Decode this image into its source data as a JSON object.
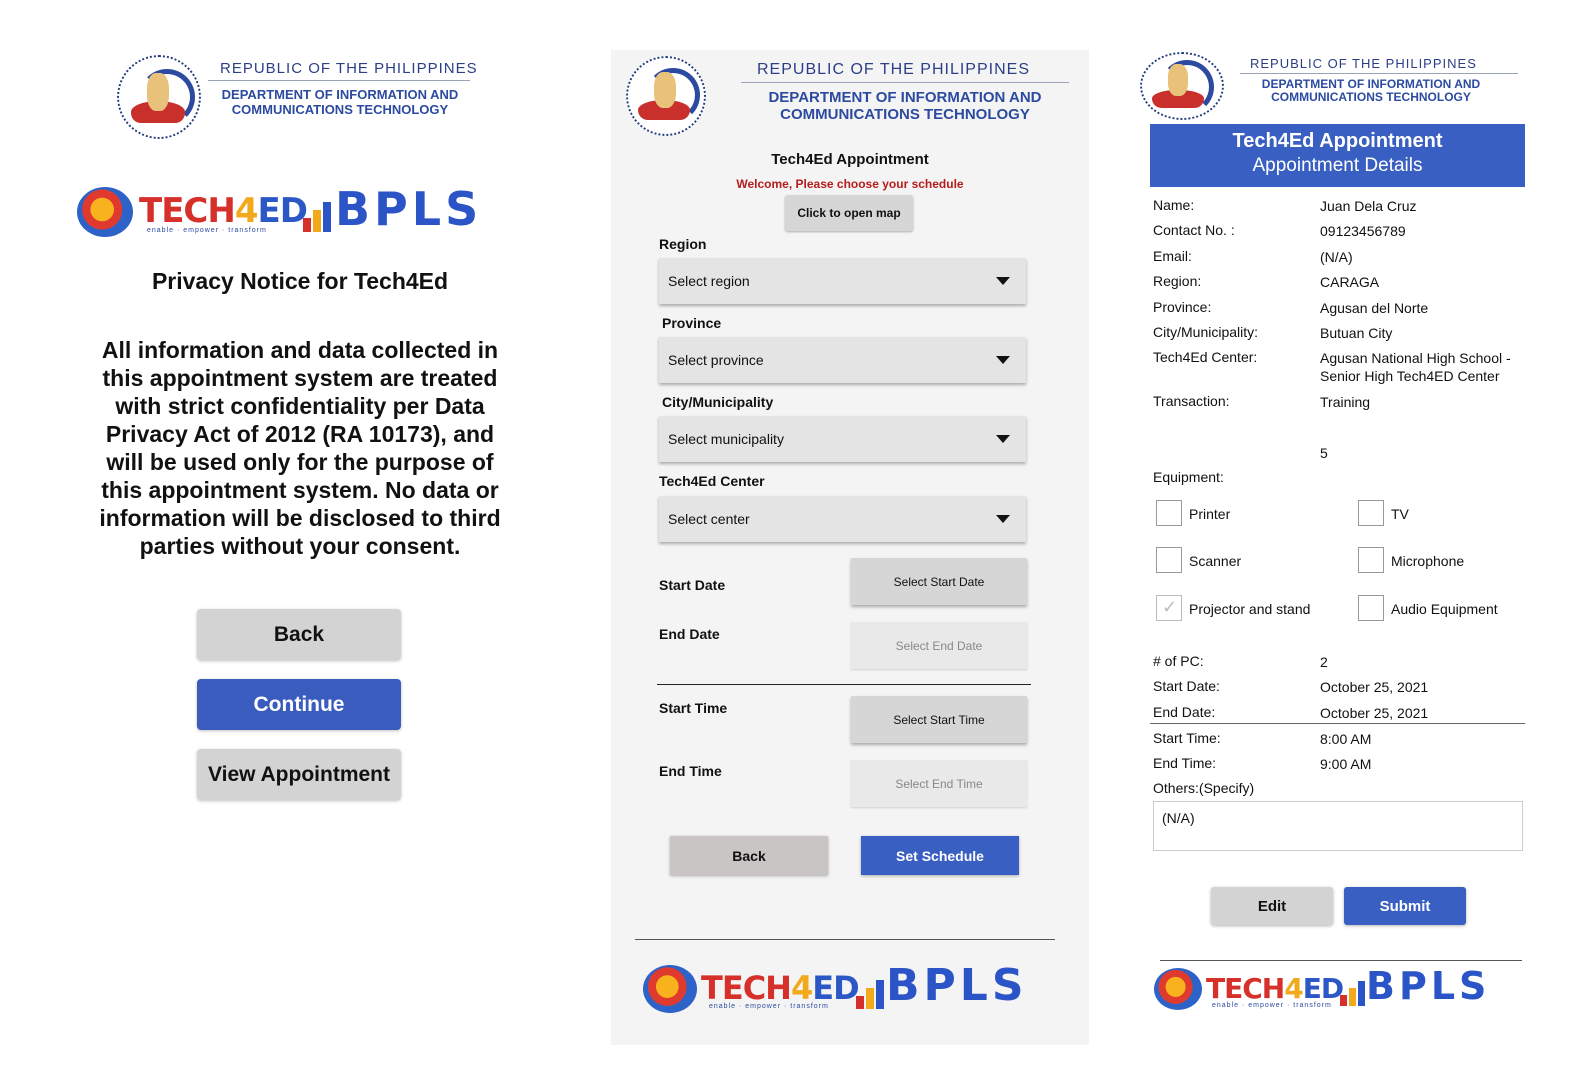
{
  "header": {
    "republic": "REPUBLIC OF THE PHILIPPINES",
    "dept_line1": "DEPARTMENT OF INFORMATION AND",
    "dept_line2": "COMMUNICATIONS TECHNOLOGY"
  },
  "logos": {
    "tech4ed": "TECH4ED",
    "tech4ed_tagline": "enable · empower · transform",
    "bpls": "BPLS"
  },
  "privacy": {
    "title": "Privacy Notice for Tech4Ed",
    "body": "All information and data collected in this appointment system are treated with strict confidentiality per Data Privacy Act of 2012 (RA 10173), and will be used only for the purpose of this appointment system. No data or information will be disclosed to third parties without your consent.",
    "back": "Back",
    "continue": "Continue",
    "view_appointment": "View Appointment"
  },
  "schedule": {
    "title": "Tech4Ed Appointment",
    "welcome": "Welcome, Please choose your schedule",
    "map_button": "Click to open map",
    "region_label": "Region",
    "region_placeholder": "Select region",
    "province_label": "Province",
    "province_placeholder": "Select province",
    "city_label": "City/Municipality",
    "city_placeholder": "Select municipality",
    "center_label": "Tech4Ed Center",
    "center_placeholder": "Select center",
    "start_date_label": "Start Date",
    "start_date_button": "Select Start Date",
    "end_date_label": "End Date",
    "end_date_button": "Select End Date",
    "start_time_label": "Start Time",
    "start_time_button": "Select Start Time",
    "end_time_label": "End Time",
    "end_time_button": "Select End Time",
    "back": "Back",
    "set_schedule": "Set Schedule"
  },
  "details": {
    "title": "Tech4Ed Appointment",
    "subtitle": "Appointment Details",
    "name_k": "Name:",
    "name_v": "Juan Dela Cruz",
    "contact_k": "Contact No. :",
    "contact_v": "09123456789",
    "email_k": "Email:",
    "email_v": "(N/A)",
    "region_k": "Region:",
    "region_v": "CARAGA",
    "province_k": "Province:",
    "province_v": "Agusan del Norte",
    "city_k": "City/Municipality:",
    "city_v": "Butuan City",
    "center_k": "Tech4Ed Center:",
    "center_v1": "Agusan National High School -",
    "center_v2": "Senior High Tech4ED Center",
    "transaction_k": "Transaction:",
    "transaction_v": "Training",
    "count_v": "5",
    "equipment_k": "Equipment:",
    "equipment": [
      {
        "label": "Printer",
        "checked": false
      },
      {
        "label": "TV",
        "checked": false
      },
      {
        "label": "Scanner",
        "checked": false
      },
      {
        "label": "Microphone",
        "checked": false
      },
      {
        "label": "Projector and stand",
        "checked": true
      },
      {
        "label": "Audio Equipment",
        "checked": false
      }
    ],
    "pc_k": "# of PC:",
    "pc_v": "2",
    "start_date_k": "Start Date:",
    "start_date_v": "October 25, 2021",
    "end_date_k": "End Date:",
    "end_date_v": "October 25, 2021",
    "start_time_k": "Start Time:",
    "start_time_v": "8:00 AM",
    "end_time_k": "End Time:",
    "end_time_v": "9:00 AM",
    "others_k": "Others:(Specify)",
    "others_v": "(N/A)",
    "edit": "Edit",
    "submit": "Submit"
  }
}
